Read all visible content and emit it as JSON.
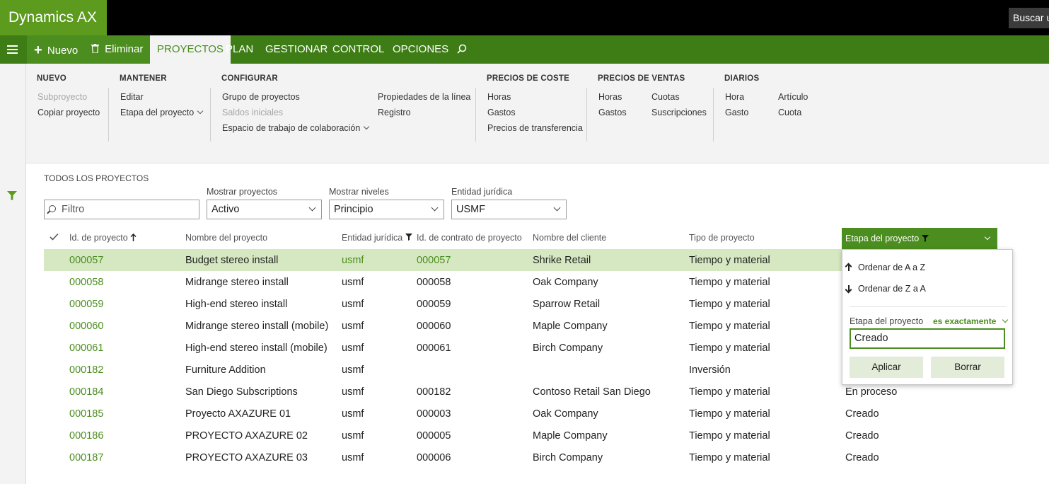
{
  "app": {
    "title": "Dynamics AX",
    "search_placeholder": "Buscar u"
  },
  "actionbar": {
    "new_label": "Nuevo",
    "delete_label": "Eliminar",
    "tabs": [
      "PROYECTOS",
      "PLAN",
      "GESTIONAR",
      "CONTROL",
      "OPCIONES"
    ],
    "active_tab": "PROYECTOS"
  },
  "ribbon": {
    "nuevo": {
      "title": "NUEVO",
      "items": [
        "Subproyecto",
        "Copiar proyecto"
      ]
    },
    "mantener": {
      "title": "MANTENER",
      "items": [
        "Editar",
        "Etapa del proyecto"
      ]
    },
    "configurar": {
      "title": "CONFIGURAR",
      "items": [
        "Grupo de proyectos",
        "Saldos iniciales",
        "Espacio de trabajo de colaboración",
        "Propiedades de la línea",
        "Registro"
      ]
    },
    "precios_coste": {
      "title": "PRECIOS DE COSTE",
      "items": [
        "Horas",
        "Gastos",
        "Precios de transferencia"
      ]
    },
    "precios_ventas": {
      "title": "PRECIOS DE VENTAS",
      "items": [
        "Horas",
        "Gastos",
        "Cuotas",
        "Suscripciones"
      ]
    },
    "diarios": {
      "title": "DIARIOS",
      "items": [
        "Hora",
        "Gasto",
        "Artículo",
        "Cuota"
      ]
    }
  },
  "page": {
    "title": "TODOS LOS PROYECTOS",
    "filter_placeholder": "Filtro",
    "mostrar_proyectos": {
      "label": "Mostrar proyectos",
      "value": "Activo"
    },
    "mostrar_niveles": {
      "label": "Mostrar niveles",
      "value": "Principio"
    },
    "entidad": {
      "label": "Entidad jurídica",
      "value": "USMF"
    }
  },
  "grid": {
    "headers": [
      "Id. de proyecto",
      "Nombre del proyecto",
      "Entidad jurídica",
      "Id. de contrato de proyecto",
      "Nombre del cliente",
      "Tipo de proyecto",
      "Etapa del proyecto"
    ],
    "rows": [
      {
        "id": "000057",
        "name": "Budget stereo install",
        "entity": "usmf",
        "contract": "000057",
        "customer": "Shrike Retail",
        "type": "Tiempo y material",
        "stage": ""
      },
      {
        "id": "000058",
        "name": "Midrange stereo install",
        "entity": "usmf",
        "contract": "000058",
        "customer": "Oak Company",
        "type": "Tiempo y material",
        "stage": ""
      },
      {
        "id": "000059",
        "name": "High-end stereo install",
        "entity": "usmf",
        "contract": "000059",
        "customer": "Sparrow Retail",
        "type": "Tiempo y material",
        "stage": ""
      },
      {
        "id": "000060",
        "name": "Midrange stereo install (mobile)",
        "entity": "usmf",
        "contract": "000060",
        "customer": "Maple Company",
        "type": "Tiempo y material",
        "stage": ""
      },
      {
        "id": "000061",
        "name": "High-end stereo install (mobile)",
        "entity": "usmf",
        "contract": "000061",
        "customer": "Birch Company",
        "type": "Tiempo y material",
        "stage": ""
      },
      {
        "id": "000182",
        "name": "Furniture Addition",
        "entity": "usmf",
        "contract": "",
        "customer": "",
        "type": "Inversión",
        "stage": ""
      },
      {
        "id": "000184",
        "name": "San Diego Subscriptions",
        "entity": "usmf",
        "contract": "000182",
        "customer": "Contoso Retail San Diego",
        "type": "Tiempo y material",
        "stage": "En proceso"
      },
      {
        "id": "000185",
        "name": "Proyecto AXAZURE 01",
        "entity": "usmf",
        "contract": "000003",
        "customer": "Oak Company",
        "type": "Tiempo y material",
        "stage": "Creado"
      },
      {
        "id": "000186",
        "name": "PROYECTO AXAZURE 02",
        "entity": "usmf",
        "contract": "000005",
        "customer": "Maple Company",
        "type": "Tiempo y material",
        "stage": "Creado"
      },
      {
        "id": "000187",
        "name": "PROYECTO AXAZURE 03",
        "entity": "usmf",
        "contract": "000006",
        "customer": "Birch Company",
        "type": "Tiempo y material",
        "stage": "Creado"
      }
    ]
  },
  "popup": {
    "sort_asc": "Ordenar de A a Z",
    "sort_desc": "Ordenar de Z a A",
    "field_label": "Etapa del proyecto",
    "operator": "es exactamente",
    "value": "Creado",
    "apply_label": "Aplicar",
    "clear_label": "Borrar"
  },
  "colors": {
    "brand": "#5c9b1e",
    "actionbar": "#3e7d16",
    "accent": "#4b8d1f",
    "selected_row": "#d6e8c2"
  }
}
